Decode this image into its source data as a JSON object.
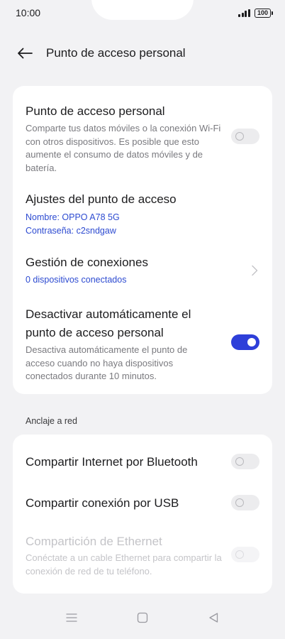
{
  "status": {
    "time": "10:00",
    "battery": "100"
  },
  "header": {
    "title": "Punto de acceso personal"
  },
  "hotspot": {
    "title": "Punto de acceso personal",
    "description": "Comparte tus datos móviles o la conexión Wi-Fi con otros dispositivos. Es posible que esto aumente el consumo de datos móviles y de batería.",
    "enabled": false
  },
  "settings": {
    "title": "Ajustes del punto de acceso",
    "name_line": "Nombre: OPPO A78 5G",
    "password_line": "Contraseña: c2sndgaw"
  },
  "connections": {
    "title": "Gestión de conexiones",
    "subtitle": "0 dispositivos conectados"
  },
  "auto_off": {
    "title": "Desactivar automáticamente el punto de acceso personal",
    "description": "Desactiva automáticamente el punto de acceso cuando no haya dispositivos conectados durante 10 minutos.",
    "enabled": true
  },
  "tethering": {
    "section_label": "Anclaje a red",
    "bluetooth": {
      "title": "Compartir Internet por Bluetooth",
      "enabled": false
    },
    "usb": {
      "title": "Compartir conexión por USB",
      "enabled": false
    },
    "ethernet": {
      "title": "Compartición de Ethernet",
      "description": "Conéctate a un cable Ethernet para compartir la conexión de red de tu teléfono.",
      "enabled": false,
      "disabled": true
    }
  },
  "colors": {
    "accent": "#2e3fd9",
    "link": "#2d4bd1",
    "background": "#f2f2f4"
  },
  "icons": {
    "back": "arrow-left-icon",
    "chevron": "chevron-right-icon",
    "menu": "menu-icon",
    "home": "home-square-icon",
    "recent": "back-triangle-icon"
  }
}
